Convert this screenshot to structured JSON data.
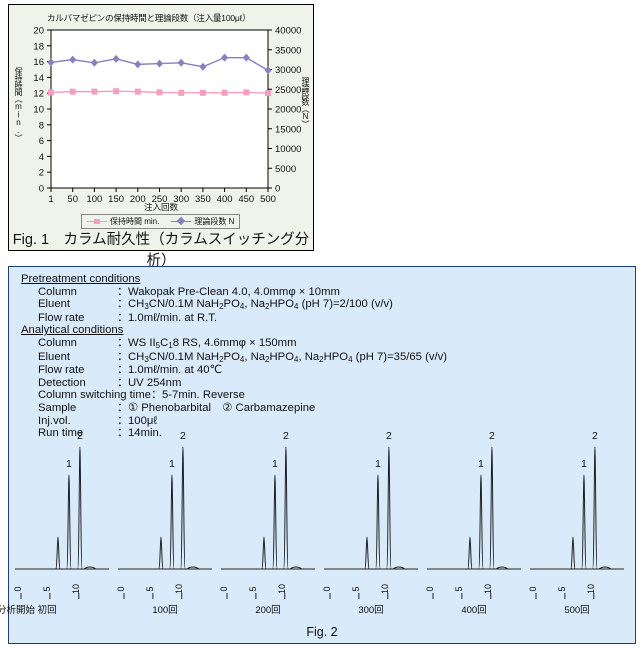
{
  "fig1": {
    "caption": "Fig. 1　カラム耐久性（カラムスイッチング分析）",
    "chart_data": {
      "type": "line",
      "title": "カルバマゼピンの保持時間と理論段数（注入量100μℓ）",
      "xlabel": "注入回数",
      "ylabel": "保持時間（min.）",
      "y2label": "理論段数（N）",
      "categories": [
        "1",
        "50",
        "100",
        "150",
        "200",
        "250",
        "300",
        "350",
        "400",
        "450",
        "500"
      ],
      "ylim": [
        0,
        20
      ],
      "yticks": [
        "0",
        "2",
        "4",
        "6",
        "8",
        "10",
        "12",
        "14",
        "16",
        "18",
        "20"
      ],
      "y2lim": [
        0,
        40000
      ],
      "y2ticks": [
        "0",
        "5000",
        "10000",
        "15000",
        "20000",
        "25000",
        "30000",
        "35000",
        "40000"
      ],
      "grid": false,
      "legend_position": "bottom",
      "series": [
        {
          "name": "保持時間 min.",
          "axis": "left",
          "color": "#f59ec0",
          "marker": "square",
          "values": [
            12.1,
            12.2,
            12.2,
            12.25,
            12.2,
            12.1,
            12.05,
            12.05,
            12.05,
            12.1,
            12.0
          ]
        },
        {
          "name": "理論段数 N",
          "axis": "right",
          "color": "#8b7fc0",
          "marker": "diamond",
          "values": [
            31800,
            32500,
            31700,
            32700,
            31300,
            31500,
            31700,
            30700,
            33000,
            33000,
            29800
          ]
        }
      ]
    }
  },
  "fig2": {
    "caption": "Fig. 2",
    "pretreatment": {
      "heading": "Pretreatment conditions",
      "rows": [
        {
          "key": "Column",
          "sep": "：",
          "value": "Wakopak Pre-Clean 4.0,  4.0mmφ × 10mm"
        },
        {
          "key": "Eluent",
          "sep": "：",
          "value": "CH3CN/0.1M NaH2PO4, Na2HPO4 (pH 7)=2/100 (v/v)"
        },
        {
          "key": "Flow rate",
          "sep": "：",
          "value": "1.0mℓ/min.  at R.T."
        }
      ]
    },
    "analytical": {
      "heading": "Analytical conditions",
      "rows": [
        {
          "key": "Column",
          "sep": "：",
          "value": "WS II5C18 RS, 4.6mmφ × 150mm"
        },
        {
          "key": "Eluent",
          "sep": "：",
          "value": "CH3CN/0.1M NaH2PO4, Na2HPO4, Na2HPO4 (pH 7)=35/65 (v/v)"
        },
        {
          "key": "Flow rate",
          "sep": "：",
          "value": "1.0mℓ/min.  at 40℃"
        },
        {
          "key": "Detection",
          "sep": "：",
          "value": "UV 254nm"
        },
        {
          "key": "Column switching time",
          "sep": "：",
          "value": "5-7min. Reverse"
        },
        {
          "key": "Sample",
          "sep": "：",
          "value": "① Phenobarbital　② Carbamazepine"
        },
        {
          "key": "Inj.vol.",
          "sep": "：",
          "value": "100μℓ"
        },
        {
          "key": "Run time",
          "sep": "：",
          "value": "14min."
        }
      ]
    },
    "chromatograms": {
      "peak_labels": [
        "1",
        "2"
      ],
      "time_ticks": [
        "0",
        "5",
        "10"
      ],
      "runs": [
        {
          "label": "分析開始 初回"
        },
        {
          "label": "100回"
        },
        {
          "label": "200回"
        },
        {
          "label": "300回"
        },
        {
          "label": "400回"
        },
        {
          "label": "500回"
        }
      ]
    }
  }
}
